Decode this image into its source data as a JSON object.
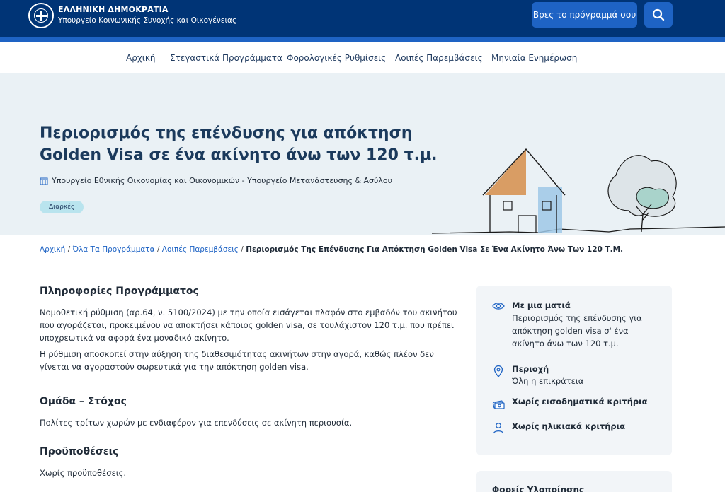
{
  "header": {
    "gov_title": "ΕΛΛΗΝΙΚΗ ΔΗΜΟΚΡΑΤΙΑ",
    "gov_subtitle": "Υπουργείο Κοινωνικής Συνοχής και Οικογένειας",
    "find_program_label": "Βρες το πρόγραμμά σου",
    "search_icon": "search-icon"
  },
  "nav": {
    "items": [
      "Αρχική",
      "Στεγαστικά Προγράμματα",
      "Φορολογικές Ρυθμίσεις",
      "Λοιπές Παρεμβάσεις",
      "Μηνιαία Ενημέρωση"
    ]
  },
  "hero": {
    "title": "Περιορισμός της επένδυσης για απόκτηση Golden Visa σε ένα ακίνητο άνω των 120 τ.μ.",
    "organization": "Υπουργείο Εθνικής Οικονομίας και Οικονομικών - Υπουργείο Μετανάστευσης & Ασύλου",
    "badge": "Διαρκές"
  },
  "breadcrumb": {
    "items": [
      "Αρχική",
      "Όλα Τα Προγράμματα",
      "Λοιπές Παρεμβάσεις"
    ],
    "separator": "/",
    "current": "Περιορισμός Της Επένδυσης Για Απόκτηση Golden Visa Σε Ένα Ακίνητο Άνω Των 120 Τ.Μ."
  },
  "content": {
    "info_title": "Πληροφορίες Προγράμματος",
    "info_p1": "Νομοθετική ρύθμιση (αρ.64, ν. 5100/2024) με την οποία εισάγεται πλαφόν στο εμβαδόν του ακινήτου που αγοράζεται, προκειμένου να αποκτήσει κάποιος golden visa, σε τουλάχιστον 120 τ.μ. που πρέπει υποχρεωτικά να αφορά ένα μοναδικό ακίνητο.",
    "info_p2": "Η ρύθμιση αποσκοπεί στην αύξηση της διαθεσιμότητας ακινήτων στην αγορά, καθώς πλέον δεν γίνεται να αγοραστούν σωρευτικά για την απόκτηση golden visa.",
    "target_title": "Ομάδα – Στόχος",
    "target_text": "Πολίτες τρίτων χωρών με ενδιαφέρον για επενδύσεις σε ακίνητη περιουσία.",
    "req_title": "Προϋποθέσεις",
    "req_text": "Χωρίς προϋποθέσεις."
  },
  "sidebar": {
    "glance_head": "Με μια ματιά",
    "glance_text": "Περιορισμός της επένδυσης για απόκτηση golden visa σ' ένα ακίνητο άνω των 120 τ.μ.",
    "region_head": "Περιοχή",
    "region_text": "Όλη η επικράτεια",
    "income_head": "Χωρίς εισοδηματικά κριτήρια",
    "age_head": "Χωρίς ηλικιακά κριτήρια",
    "card2_head": "Φορείς Υλοποίησης"
  },
  "colors": {
    "header_bg": "#003476",
    "accent": "#1e63c4",
    "hero_bg": "#eaf1f5",
    "badge_bg": "#b9e4ee"
  }
}
